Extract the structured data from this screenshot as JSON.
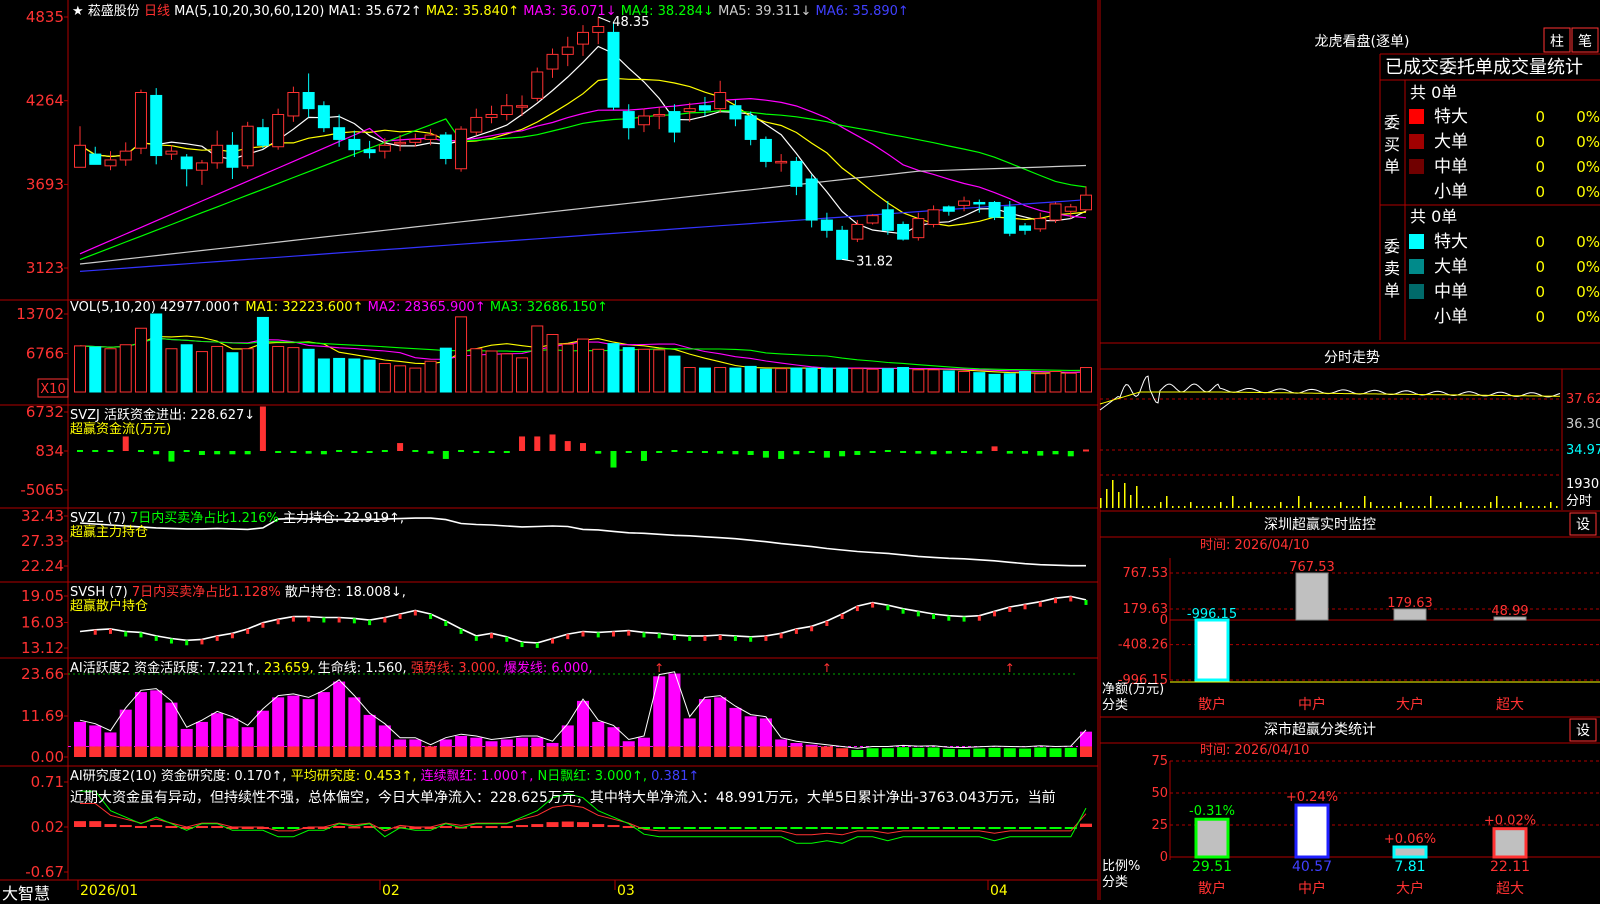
{
  "stock": {
    "star": "★",
    "name": "菘盛股份",
    "period": "日线"
  },
  "ma_header": {
    "prefix": "MA(5,10,20,30,60,120)",
    "items": [
      {
        "label": "MA1: 35.672↑",
        "color": "#ffffff"
      },
      {
        "label": "MA2: 35.840↑",
        "color": "#ffff00"
      },
      {
        "label": "MA3: 36.071↓",
        "color": "#ff00ff"
      },
      {
        "label": "MA4: 38.284↓",
        "color": "#00ff00"
      },
      {
        "label": "MA5: 39.311↓",
        "color": "#cccccc"
      },
      {
        "label": "MA6: 35.890↑",
        "color": "#3333ff"
      }
    ]
  },
  "price_axis": [
    "4835",
    "4264",
    "3693",
    "3123"
  ],
  "price_annotations": {
    "high": "48.35",
    "low": "31.82"
  },
  "vol_header": {
    "prefix": "VOL(5,10,20)",
    "value": "42977.000↑",
    "items": [
      {
        "label": "MA1: 32223.600↑",
        "color": "#ffff00"
      },
      {
        "label": "MA2: 28365.900↑",
        "color": "#ff00ff"
      },
      {
        "label": "MA3: 32686.150↑",
        "color": "#00ff00"
      }
    ]
  },
  "vol_axis": [
    "13702",
    "6766"
  ],
  "vol_unit": "X10",
  "svzj": {
    "title": "SVZJ  活跃资金进出: 228.627↓",
    "sub": "超赢资金流(万元)",
    "axis": [
      "6732",
      "834",
      "-5065"
    ]
  },
  "svzl": {
    "title_a": "SVZL (7)",
    "title_b": "7日内买卖净占比1.216%",
    "title_c": "主力持仓: 22.919↑,",
    "sub": "超赢主力持仓",
    "axis": [
      "32.43",
      "27.33",
      "22.24"
    ]
  },
  "svsh": {
    "title_a": "SVSH (7)",
    "title_b": "7日内买卖净占比1.128%",
    "title_c": "散户持仓: 18.008↓,",
    "sub": "超赢散户持仓",
    "axis": [
      "19.05",
      "16.03",
      "13.12"
    ]
  },
  "ai_active": {
    "title": "AI活跃度2 资金活跃度: 7.221↑,",
    "v2": "23.659,",
    "v3": "生命线: 1.560,",
    "v4": "强势线: 3.000,",
    "v5": "爆发线: 6.000,",
    "axis": [
      "23.66",
      "11.69",
      "0.00"
    ]
  },
  "ai_research": {
    "title": "AI研究度2(10) 资金研究度: 0.170↑,",
    "v2": "平均研究度: 0.453↑,",
    "v3": "连续飘红: 1.000↑,",
    "v4": "N日飘红: 3.000↑,",
    "v5": "0.381↑",
    "text": "近期大资金虽有异动，但持续性不强，总体偏空，今日大单净流入：228.625万元，其中特大单净流入：48.991万元，大单5日累计净出-3763.043万元，当前",
    "axis": [
      "0.71",
      "0.02",
      "-0.67"
    ]
  },
  "date_axis": [
    "2026/01",
    "02",
    "03",
    "04"
  ],
  "brand": "大智慧",
  "right_panel": {
    "lhb_title": "龙虎看盘(逐单)",
    "tab_zhu": "柱",
    "tab_bi": "笔",
    "stat_title": "已成交委托单成交量统计",
    "buy_label": [
      "委",
      "买",
      "单"
    ],
    "sell_label": [
      "委",
      "卖",
      "单"
    ],
    "buy_total": "共 0单",
    "sell_total": "共 0单",
    "buy_rows": [
      {
        "name": "特大",
        "count": "0",
        "pct": "0%",
        "color": "#ff0000"
      },
      {
        "name": "大单",
        "count": "0",
        "pct": "0%",
        "color": "#a00000"
      },
      {
        "name": "中单",
        "count": "0",
        "pct": "0%",
        "color": "#700000"
      },
      {
        "name": "小单",
        "count": "0",
        "pct": "0%",
        "color": ""
      }
    ],
    "sell_rows": [
      {
        "name": "特大",
        "count": "0",
        "pct": "0%",
        "color": "#00ffff"
      },
      {
        "name": "大单",
        "count": "0",
        "pct": "0%",
        "color": "#008a8a"
      },
      {
        "name": "中单",
        "count": "0",
        "pct": "0%",
        "color": "#006a6a"
      },
      {
        "name": "小单",
        "count": "0",
        "pct": "0%",
        "color": ""
      }
    ],
    "intraday_title": "分时走势",
    "intraday_axis": [
      "37.62",
      "36.30",
      "34.97",
      "1930"
    ],
    "intraday_unit": "分时",
    "monitor": {
      "title": "深圳超赢实时监控",
      "settings": "设",
      "time": "时间: 2026/04/10",
      "axis": [
        "767.53",
        "179.63",
        "0",
        "-408.26",
        "-996.15"
      ],
      "ylabel": "净额(万元)",
      "xlabel": "分类",
      "categories": [
        "散户",
        "中户",
        "大户",
        "超大"
      ],
      "values": [
        "-996.15",
        "767.53",
        "179.63",
        "48.99"
      ]
    },
    "classify": {
      "title": "深市超赢分类统计",
      "settings": "设",
      "time": "时间: 2026/04/10",
      "axis": [
        "75",
        "50",
        "25",
        "0"
      ],
      "ylabel": "比例%",
      "xlabel": "分类",
      "categories": [
        "散户",
        "中户",
        "大户",
        "超大"
      ],
      "changes": [
        "-0.31%",
        "+0.24%",
        "+0.06%",
        "+0.02%"
      ],
      "values": [
        "29.51",
        "40.57",
        "7.81",
        "22.11"
      ]
    }
  },
  "chart_data": {
    "type": "candlestick",
    "candles": [
      [
        38.1,
        39.6,
        39.0,
        40.9
      ],
      [
        39.0,
        38.3,
        38.3,
        39.5
      ],
      [
        38.2,
        38.6,
        37.9,
        39.2
      ],
      [
        38.6,
        39.2,
        38.2,
        39.8
      ],
      [
        39.4,
        43.2,
        39.0,
        43.4
      ],
      [
        43.0,
        38.9,
        38.3,
        43.5
      ],
      [
        39.0,
        39.2,
        38.6,
        39.6
      ],
      [
        38.8,
        38.0,
        36.8,
        39.0
      ],
      [
        37.9,
        38.4,
        36.9,
        38.6
      ],
      [
        38.4,
        39.6,
        38.0,
        40.6
      ],
      [
        39.6,
        38.1,
        37.3,
        40.5
      ],
      [
        38.2,
        40.9,
        38.0,
        41.2
      ],
      [
        40.8,
        39.6,
        39.4,
        41.4
      ],
      [
        39.5,
        41.7,
        39.3,
        42.1
      ],
      [
        41.6,
        43.2,
        41.2,
        43.6
      ],
      [
        43.2,
        42.1,
        41.5,
        44.5
      ],
      [
        42.3,
        40.8,
        40.5,
        42.6
      ],
      [
        40.8,
        40.0,
        39.5,
        41.7
      ],
      [
        40.0,
        39.3,
        38.8,
        40.6
      ],
      [
        39.3,
        39.1,
        38.7,
        39.9
      ],
      [
        39.2,
        39.6,
        38.7,
        40.1
      ],
      [
        39.7,
        39.8,
        39.2,
        40.3
      ],
      [
        39.8,
        40.0,
        39.5,
        40.4
      ],
      [
        40.0,
        40.3,
        39.6,
        40.7
      ],
      [
        40.3,
        38.7,
        38.3,
        40.5
      ],
      [
        38.0,
        40.7,
        37.8,
        40.9
      ],
      [
        40.5,
        41.5,
        40.3,
        42.1
      ],
      [
        41.5,
        41.7,
        41.1,
        42.3
      ],
      [
        41.7,
        42.3,
        41.3,
        43.1
      ],
      [
        42.3,
        42.3,
        41.6,
        43.0
      ],
      [
        42.8,
        44.6,
        42.6,
        44.9
      ],
      [
        44.8,
        45.8,
        44.2,
        46.2
      ],
      [
        45.8,
        46.3,
        45.0,
        47.0
      ],
      [
        46.5,
        47.3,
        45.7,
        47.8
      ],
      [
        47.3,
        47.7,
        46.5,
        48.35
      ],
      [
        47.3,
        42.2,
        42.0,
        48.0
      ],
      [
        41.9,
        40.8,
        40.0,
        42.4
      ],
      [
        41.0,
        41.6,
        40.5,
        42.1
      ],
      [
        41.6,
        41.7,
        40.7,
        42.2
      ],
      [
        41.9,
        40.5,
        39.8,
        42.4
      ],
      [
        41.9,
        42.1,
        41.2,
        42.5
      ],
      [
        42.3,
        42.0,
        41.6,
        42.9
      ],
      [
        42.1,
        43.2,
        41.8,
        44.0
      ],
      [
        42.3,
        41.4,
        40.9,
        42.7
      ],
      [
        41.6,
        40.0,
        39.6,
        41.9
      ],
      [
        40.0,
        38.5,
        38.1,
        40.2
      ],
      [
        38.5,
        38.5,
        37.8,
        39.0
      ],
      [
        38.5,
        36.8,
        36.2,
        38.8
      ],
      [
        37.3,
        34.5,
        34.0,
        37.6
      ],
      [
        34.5,
        33.8,
        33.3,
        35.0
      ],
      [
        33.8,
        31.82,
        31.82,
        34.1
      ],
      [
        33.2,
        34.2,
        33.0,
        34.5
      ],
      [
        34.3,
        34.8,
        34.2,
        34.9
      ],
      [
        35.2,
        33.8,
        33.5,
        35.8
      ],
      [
        34.2,
        33.2,
        33.1,
        34.4
      ],
      [
        33.3,
        34.6,
        33.1,
        35.0
      ],
      [
        34.2,
        35.2,
        34.0,
        35.5
      ],
      [
        35.4,
        35.1,
        34.8,
        35.5
      ],
      [
        35.5,
        35.8,
        35.1,
        36.1
      ],
      [
        35.7,
        35.6,
        35.0,
        35.9
      ],
      [
        35.7,
        34.7,
        34.5,
        35.8
      ],
      [
        35.4,
        33.6,
        33.4,
        35.8
      ],
      [
        34.1,
        33.8,
        33.5,
        34.3
      ],
      [
        33.9,
        34.6,
        33.7,
        35.0
      ],
      [
        34.5,
        35.6,
        34.3,
        35.7
      ],
      [
        35.1,
        35.4,
        34.6,
        35.6
      ],
      [
        35.2,
        36.2,
        35.1,
        36.8
      ]
    ],
    "ma_values": {
      "MA1": 35.672,
      "MA2": 35.84,
      "MA3": 36.071,
      "MA4": 38.284,
      "MA5": 39.311,
      "MA6": 35.89
    },
    "volume_x10": [
      8100,
      7900,
      7600,
      8300,
      11200,
      13702,
      7600,
      8300,
      7100,
      8000,
      6900,
      7600,
      13100,
      8000,
      7800,
      7500,
      5800,
      5900,
      5800,
      5600,
      5000,
      4600,
      4200,
      5400,
      7700,
      13200,
      7600,
      7200,
      6700,
      6000,
      11600,
      10100,
      8400,
      9300,
      7500,
      8500,
      7800,
      7500,
      7400,
      6300,
      4300,
      4200,
      4300,
      4200,
      4500,
      4000,
      4100,
      4200,
      4200,
      4200,
      4200,
      4100,
      4000,
      4100,
      4300,
      3900,
      3900,
      3700,
      3600,
      3400,
      3100,
      3200,
      3600,
      3200,
      3600,
      3300,
      4297
    ],
    "fund_flow": [
      0,
      0,
      0,
      2200,
      0,
      -500,
      -1600,
      0,
      -600,
      -500,
      -500,
      -500,
      -700,
      -300,
      -200,
      -400,
      -500,
      0,
      -300,
      -200,
      0,
      1200,
      0,
      -400,
      -1200,
      0,
      -300,
      -200,
      -300,
      2200,
      2200,
      2500,
      1500,
      1200,
      -400,
      -2500,
      -300,
      -1500,
      -300,
      0,
      -200,
      -300,
      -400,
      -500,
      -600,
      -1000,
      -1200,
      -500,
      -300,
      -1000,
      -800,
      -600,
      -300,
      0,
      -300,
      -400,
      -500,
      -400,
      -200,
      -400,
      700,
      -400,
      -400,
      -700,
      -500,
      -800,
      228.627
    ],
    "fund_flow_extra": {
      "index": 12,
      "value": 6732
    },
    "main_holdings": [
      31.0,
      30.8,
      30.6,
      30.4,
      30.2,
      30.0,
      29.9,
      29.8,
      29.8,
      29.9,
      29.8,
      29.7,
      30.0,
      31.8,
      31.9,
      31.8,
      31.7,
      31.7,
      31.7,
      31.7,
      31.8,
      31.9,
      32.0,
      32.0,
      31.7,
      30.9,
      30.7,
      30.6,
      30.4,
      30.2,
      30.3,
      30.4,
      30.3,
      29.7,
      29.6,
      29.3,
      29.0,
      28.9,
      28.7,
      28.5,
      28.4,
      28.2,
      28.0,
      27.8,
      27.5,
      27.2,
      26.8,
      26.5,
      26.2,
      25.8,
      25.5,
      25.2,
      25.0,
      24.8,
      24.5,
      24.2,
      24.0,
      23.8,
      23.7,
      23.5,
      23.3,
      23.0,
      22.7,
      22.5,
      22.4,
      22.3,
      22.3
    ],
    "retail_holdings": [
      15.0,
      15.2,
      15.3,
      15.0,
      14.9,
      14.5,
      14.2,
      14.0,
      14.1,
      14.5,
      14.8,
      15.3,
      16.0,
      16.4,
      16.7,
      16.7,
      16.6,
      16.6,
      16.5,
      16.3,
      16.6,
      17.0,
      17.4,
      17.0,
      16.2,
      15.3,
      14.5,
      14.8,
      14.4,
      13.8,
      13.7,
      14.2,
      14.7,
      15.0,
      14.9,
      15.0,
      15.1,
      14.9,
      14.8,
      14.6,
      14.5,
      14.5,
      14.6,
      14.5,
      14.4,
      14.5,
      14.8,
      15.3,
      15.6,
      16.2,
      17.0,
      17.9,
      18.3,
      18.0,
      17.6,
      17.3,
      17.0,
      16.8,
      16.7,
      16.8,
      17.3,
      17.8,
      18.1,
      18.4,
      18.8,
      19.0,
      18.6
    ],
    "ai_activity": [
      10.0,
      9.0,
      7.0,
      13.5,
      18.5,
      19.0,
      15.5,
      8.0,
      10.0,
      12.5,
      11.0,
      8.5,
      13.2,
      17.0,
      17.5,
      16.5,
      18.5,
      21.5,
      17.0,
      12.0,
      9.0,
      5.0,
      5.0,
      3.0,
      5.0,
      6.0,
      5.5,
      4.5,
      5.0,
      5.5,
      5.5,
      4.0,
      9.0,
      16.0,
      10.0,
      8.5,
      4.5,
      5.5,
      23.0,
      23.8,
      11.0,
      16.5,
      17.0,
      14.0,
      11.6,
      11.0,
      5.0,
      4.0,
      3.5,
      3.0,
      2.5,
      -2.0,
      -2.5,
      -2.5,
      -2.8,
      -2.6,
      -2.7,
      -2.3,
      -2.2,
      -2.4,
      -2.6,
      -2.5,
      -2.4,
      -2.7,
      -2.5,
      -2.6,
      7.221
    ],
    "ai_research": [
      0.3,
      0.3,
      0.15,
      0.1,
      0.05,
      0.1,
      0.05,
      0.0,
      0.05,
      0.05,
      0.0,
      0.0,
      0.0,
      -0.05,
      -0.05,
      0.0,
      0.0,
      0.05,
      0.03,
      0.05,
      -0.05,
      0.02,
      0.0,
      0.0,
      0.05,
      0.02,
      0.05,
      0.05,
      0.05,
      0.1,
      0.15,
      0.25,
      0.28,
      0.25,
      0.15,
      0.1,
      0.05,
      -0.03,
      -0.05,
      -0.05,
      -0.05,
      -0.05,
      -0.05,
      -0.05,
      -0.05,
      -0.05,
      -0.05,
      -0.1,
      -0.1,
      -0.08,
      -0.1,
      -0.05,
      -0.05,
      -0.08,
      -0.05,
      -0.05,
      -0.05,
      -0.05,
      -0.05,
      -0.05,
      -0.08,
      -0.05,
      -0.05,
      -0.05,
      -0.05,
      -0.05,
      0.17
    ],
    "monitor_values": [
      -996.15,
      767.53,
      179.63,
      48.99
    ],
    "classify_values": [
      29.51,
      40.57,
      7.81,
      22.11
    ]
  }
}
